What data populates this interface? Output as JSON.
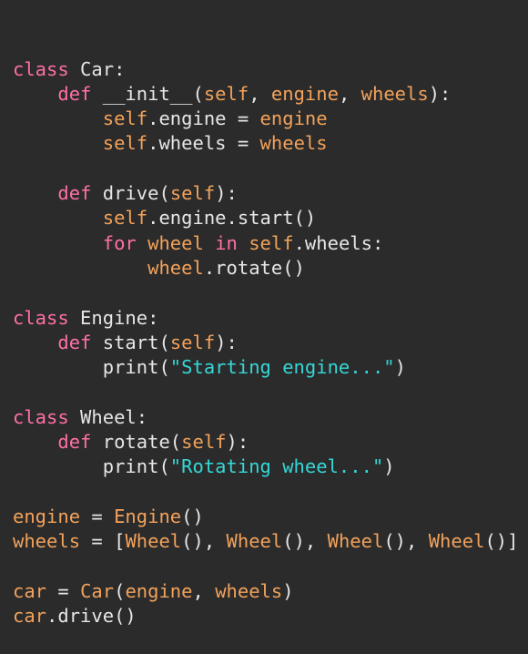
{
  "theme": {
    "background": "#2b2b2b",
    "default_text": "#e6e6e6"
  },
  "token_colors": {
    "keyword": "#ff6fa6",
    "identifier": "#e6e6e6",
    "self": "#f2a25b",
    "parameter": "#f2a25b",
    "variable": "#f2a25b",
    "class_call": "#f2a25b",
    "string": "#35d7d7",
    "operator": "#e6e6e6",
    "punctuation": "#e6e6e6"
  },
  "code": {
    "lines": [
      [
        {
          "t": "class",
          "k": "keyword"
        },
        {
          "t": " Car:",
          "k": "identifier"
        }
      ],
      [
        {
          "t": "    ",
          "k": "identifier"
        },
        {
          "t": "def",
          "k": "keyword"
        },
        {
          "t": " __init__(",
          "k": "identifier"
        },
        {
          "t": "self",
          "k": "self"
        },
        {
          "t": ", ",
          "k": "punctuation"
        },
        {
          "t": "engine",
          "k": "parameter"
        },
        {
          "t": ", ",
          "k": "punctuation"
        },
        {
          "t": "wheels",
          "k": "parameter"
        },
        {
          "t": "):",
          "k": "punctuation"
        }
      ],
      [
        {
          "t": "        ",
          "k": "identifier"
        },
        {
          "t": "self",
          "k": "self"
        },
        {
          "t": ".engine = ",
          "k": "identifier"
        },
        {
          "t": "engine",
          "k": "variable"
        }
      ],
      [
        {
          "t": "        ",
          "k": "identifier"
        },
        {
          "t": "self",
          "k": "self"
        },
        {
          "t": ".wheels = ",
          "k": "identifier"
        },
        {
          "t": "wheels",
          "k": "variable"
        }
      ],
      [],
      [
        {
          "t": "    ",
          "k": "identifier"
        },
        {
          "t": "def",
          "k": "keyword"
        },
        {
          "t": " drive(",
          "k": "identifier"
        },
        {
          "t": "self",
          "k": "self"
        },
        {
          "t": "):",
          "k": "punctuation"
        }
      ],
      [
        {
          "t": "        ",
          "k": "identifier"
        },
        {
          "t": "self",
          "k": "self"
        },
        {
          "t": ".engine.start()",
          "k": "identifier"
        }
      ],
      [
        {
          "t": "        ",
          "k": "identifier"
        },
        {
          "t": "for",
          "k": "keyword"
        },
        {
          "t": " ",
          "k": "identifier"
        },
        {
          "t": "wheel",
          "k": "variable"
        },
        {
          "t": " ",
          "k": "identifier"
        },
        {
          "t": "in",
          "k": "keyword"
        },
        {
          "t": " ",
          "k": "identifier"
        },
        {
          "t": "self",
          "k": "self"
        },
        {
          "t": ".wheels:",
          "k": "identifier"
        }
      ],
      [
        {
          "t": "            ",
          "k": "identifier"
        },
        {
          "t": "wheel",
          "k": "variable"
        },
        {
          "t": ".rotate()",
          "k": "identifier"
        }
      ],
      [],
      [
        {
          "t": "class",
          "k": "keyword"
        },
        {
          "t": " Engine:",
          "k": "identifier"
        }
      ],
      [
        {
          "t": "    ",
          "k": "identifier"
        },
        {
          "t": "def",
          "k": "keyword"
        },
        {
          "t": " start(",
          "k": "identifier"
        },
        {
          "t": "self",
          "k": "self"
        },
        {
          "t": "):",
          "k": "punctuation"
        }
      ],
      [
        {
          "t": "        print(",
          "k": "identifier"
        },
        {
          "t": "\"Starting engine...\"",
          "k": "string"
        },
        {
          "t": ")",
          "k": "punctuation"
        }
      ],
      [],
      [
        {
          "t": "class",
          "k": "keyword"
        },
        {
          "t": " Wheel:",
          "k": "identifier"
        }
      ],
      [
        {
          "t": "    ",
          "k": "identifier"
        },
        {
          "t": "def",
          "k": "keyword"
        },
        {
          "t": " rotate(",
          "k": "identifier"
        },
        {
          "t": "self",
          "k": "self"
        },
        {
          "t": "):",
          "k": "punctuation"
        }
      ],
      [
        {
          "t": "        print(",
          "k": "identifier"
        },
        {
          "t": "\"Rotating wheel...\"",
          "k": "string"
        },
        {
          "t": ")",
          "k": "punctuation"
        }
      ],
      [],
      [
        {
          "t": "engine",
          "k": "variable"
        },
        {
          "t": " = ",
          "k": "operator"
        },
        {
          "t": "Engine",
          "k": "class_call"
        },
        {
          "t": "()",
          "k": "punctuation"
        }
      ],
      [
        {
          "t": "wheels",
          "k": "variable"
        },
        {
          "t": " = [",
          "k": "operator"
        },
        {
          "t": "Wheel",
          "k": "class_call"
        },
        {
          "t": "(), ",
          "k": "punctuation"
        },
        {
          "t": "Wheel",
          "k": "class_call"
        },
        {
          "t": "(), ",
          "k": "punctuation"
        },
        {
          "t": "Wheel",
          "k": "class_call"
        },
        {
          "t": "(), ",
          "k": "punctuation"
        },
        {
          "t": "Wheel",
          "k": "class_call"
        },
        {
          "t": "()]",
          "k": "punctuation"
        }
      ],
      [],
      [
        {
          "t": "car",
          "k": "variable"
        },
        {
          "t": " = ",
          "k": "operator"
        },
        {
          "t": "Car",
          "k": "class_call"
        },
        {
          "t": "(",
          "k": "punctuation"
        },
        {
          "t": "engine",
          "k": "variable"
        },
        {
          "t": ", ",
          "k": "punctuation"
        },
        {
          "t": "wheels",
          "k": "variable"
        },
        {
          "t": ")",
          "k": "punctuation"
        }
      ],
      [
        {
          "t": "car",
          "k": "variable"
        },
        {
          "t": ".drive()",
          "k": "identifier"
        }
      ]
    ]
  }
}
